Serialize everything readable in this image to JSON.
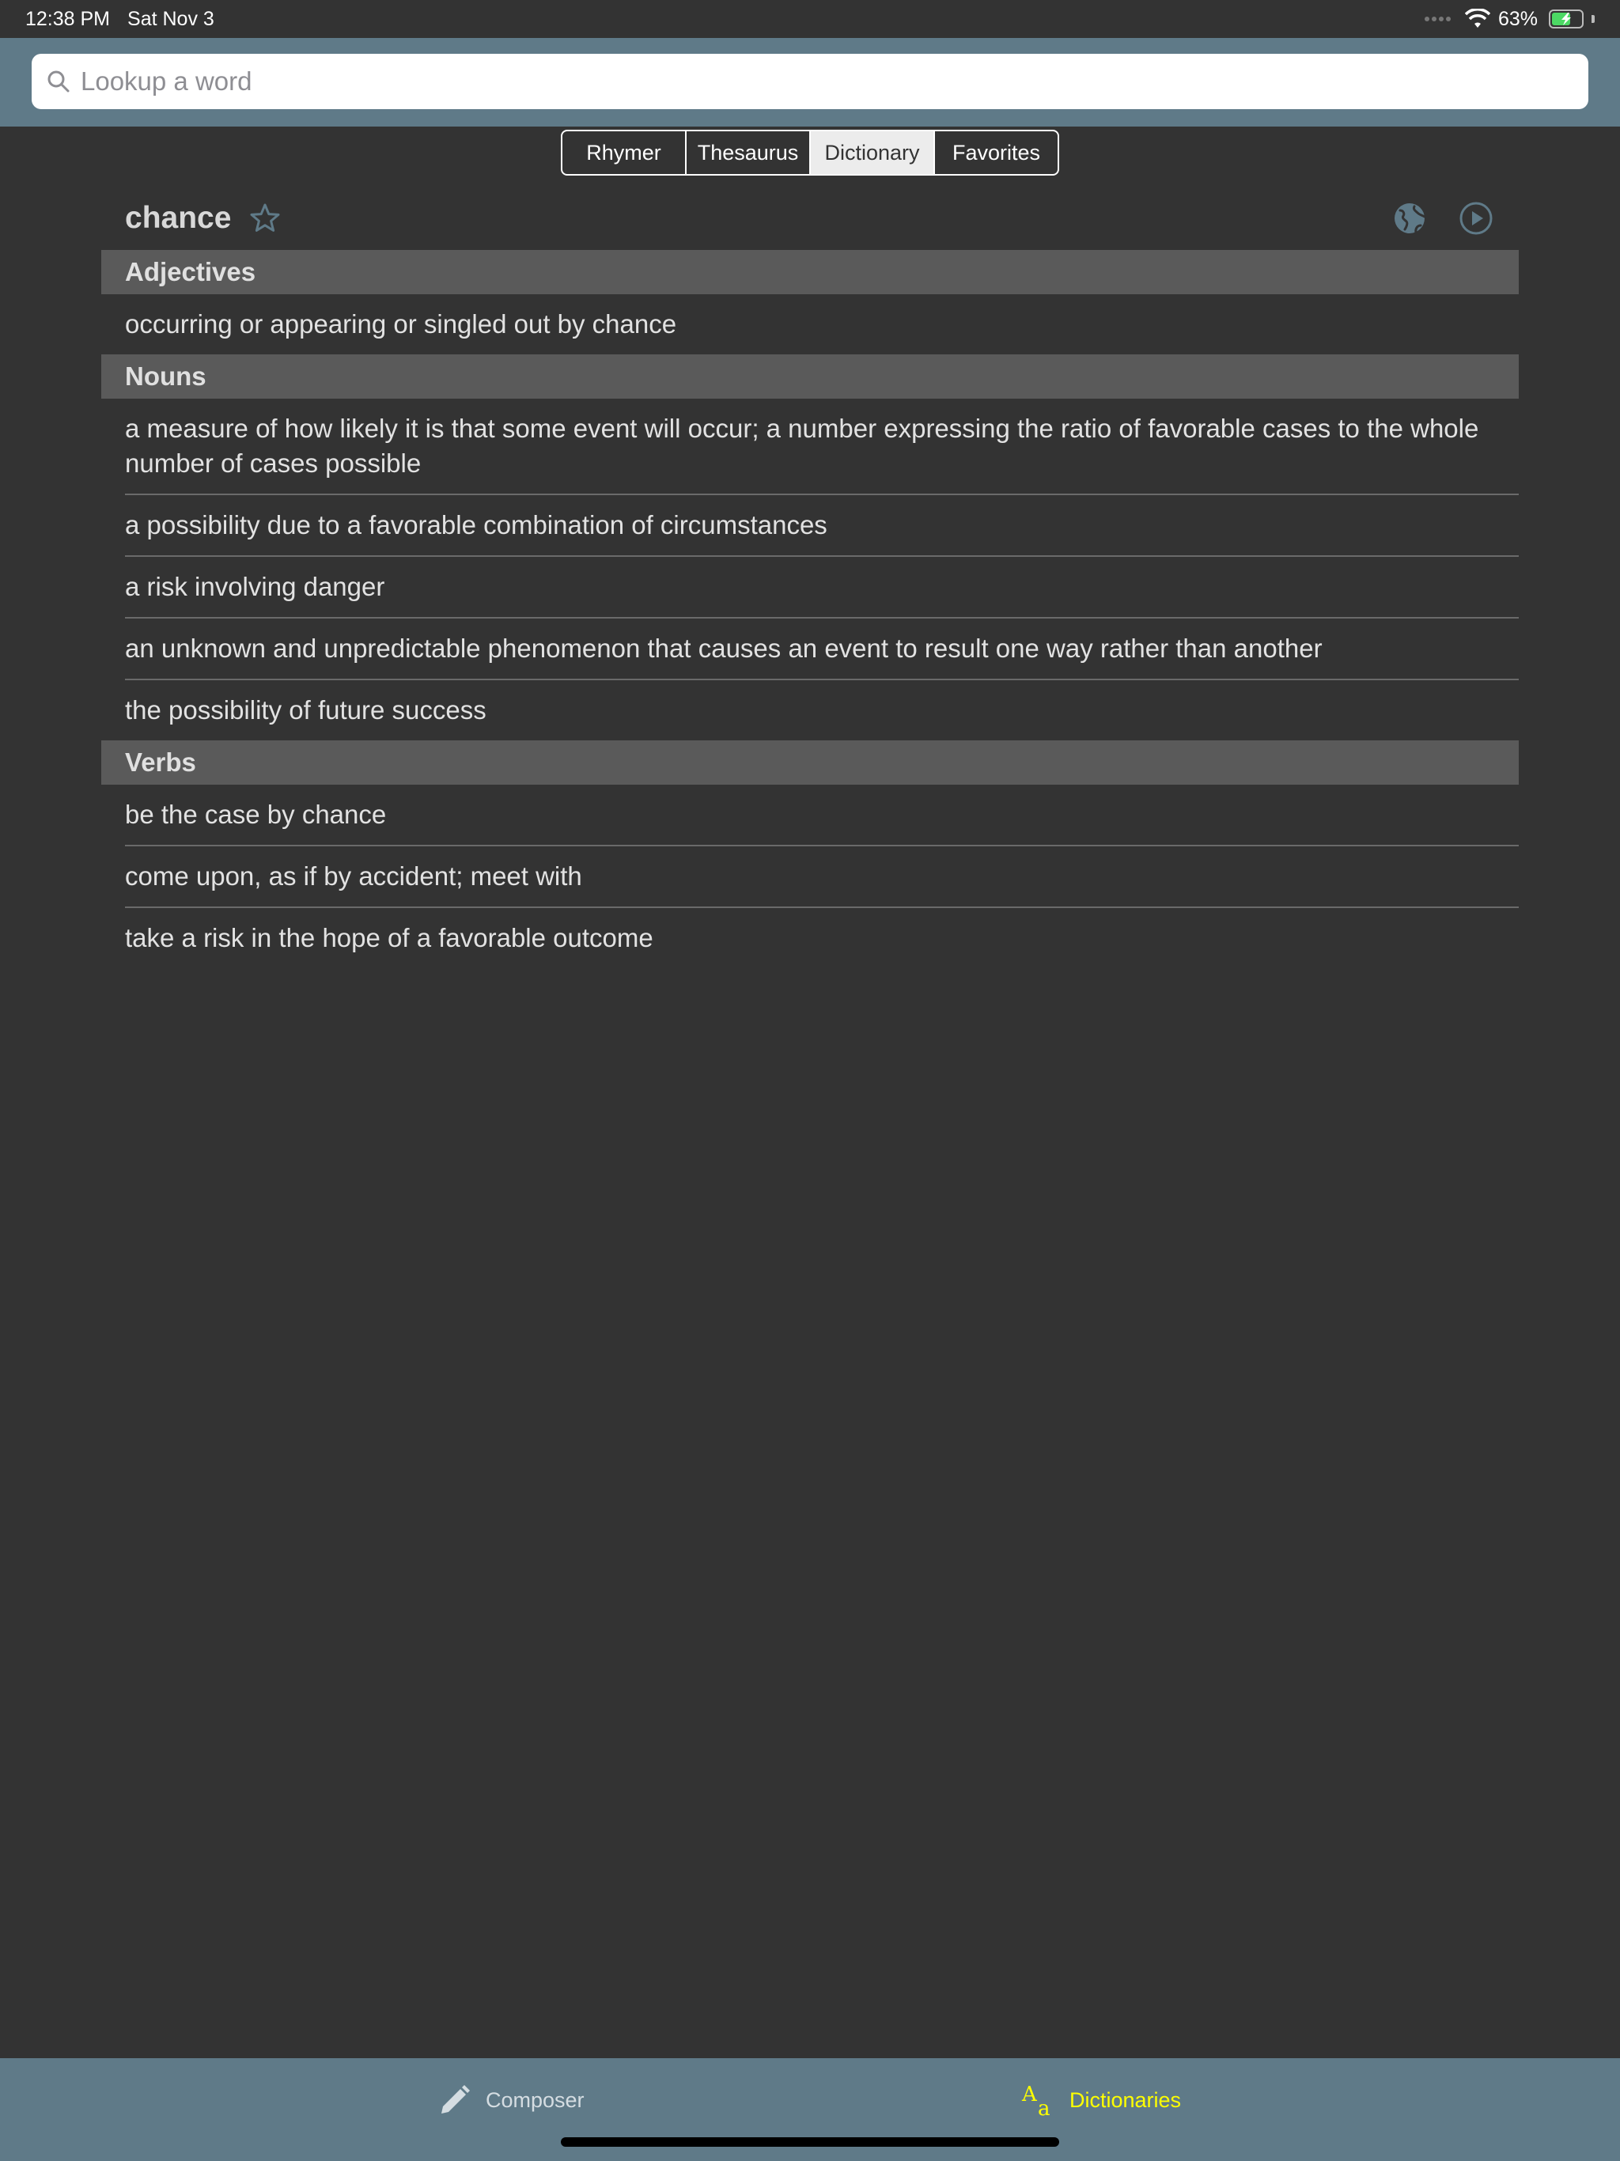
{
  "status_bar": {
    "time": "12:38 PM",
    "date": "Sat Nov 3",
    "battery_percent": "63%",
    "battery_level": 0.63
  },
  "search": {
    "placeholder": "Lookup a word"
  },
  "tabs_top": [
    {
      "label": "Rhymer",
      "active": false
    },
    {
      "label": "Thesaurus",
      "active": false
    },
    {
      "label": "Dictionary",
      "active": true
    },
    {
      "label": "Favorites",
      "active": false
    }
  ],
  "word": {
    "title": "chance",
    "favorite_icon": "star-icon",
    "actions": [
      "globe-icon",
      "play-icon"
    ]
  },
  "sections": [
    {
      "heading": "Adjectives",
      "definitions": [
        "occurring or appearing or singled out by chance"
      ]
    },
    {
      "heading": "Nouns",
      "definitions": [
        "a measure of how likely it is that some event will occur; a number expressing the ratio of favorable cases to the whole number of cases possible",
        "a possibility due to a favorable combination of circumstances",
        "a risk involving danger",
        "an unknown and unpredictable phenomenon that causes an event to result one way rather than another",
        "the possibility of future success"
      ]
    },
    {
      "heading": "Verbs",
      "definitions": [
        "be the case by chance",
        "come upon, as if by accident; meet with",
        "take a risk in the hope of a favorable outcome"
      ]
    }
  ],
  "tab_bar": {
    "composer": {
      "label": "Composer",
      "icon": "pencil-icon"
    },
    "dictionaries": {
      "label": "Dictionaries",
      "icon": "font-size-icon",
      "active": true
    }
  },
  "colors": {
    "background": "#333333",
    "header": "#5f7a88",
    "accent": "#ffff00",
    "section_header": "#5a5a5a",
    "icon": "#5f7a88"
  }
}
